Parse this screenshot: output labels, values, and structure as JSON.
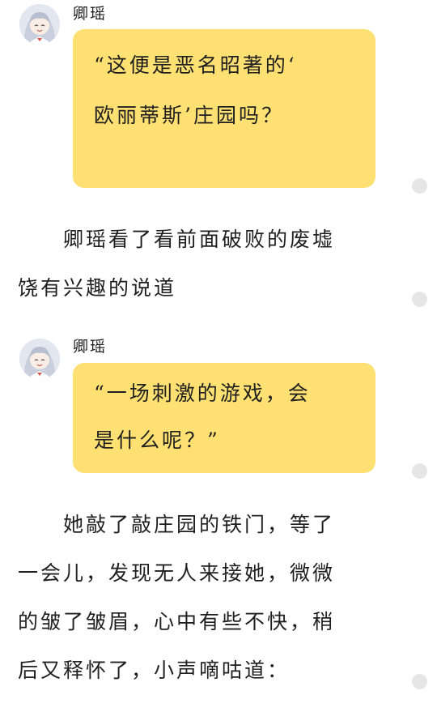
{
  "messages": [
    {
      "speaker": "卿瑶",
      "avatar_icon": "anime-girl-avatar-icon",
      "line1": "“这便是恶名昭著的‘",
      "line2": "欧丽蒂斯’庄园吗？"
    },
    {
      "speaker": "卿瑶",
      "avatar_icon": "anime-girl-avatar-icon",
      "line1": "“一场刺激的游戏，会",
      "line2": "是什么呢？”"
    }
  ],
  "narration": [
    {
      "lines": [
        "　　卿瑶看了看前面破败的废墟",
        "饶有兴趣的说道"
      ]
    },
    {
      "lines": [
        "　　她敲了敲庄园的铁门，等了",
        "一会儿，发现无人来接她，微微",
        "的皱了皱眉，心中有些不快，稍",
        "后又释怀了，小声嘀咕道："
      ]
    }
  ],
  "colors": {
    "bubble": "#ffe072",
    "background": "#ffffff",
    "text": "#1f1f1f",
    "side_dot": "#e6e6e6"
  }
}
